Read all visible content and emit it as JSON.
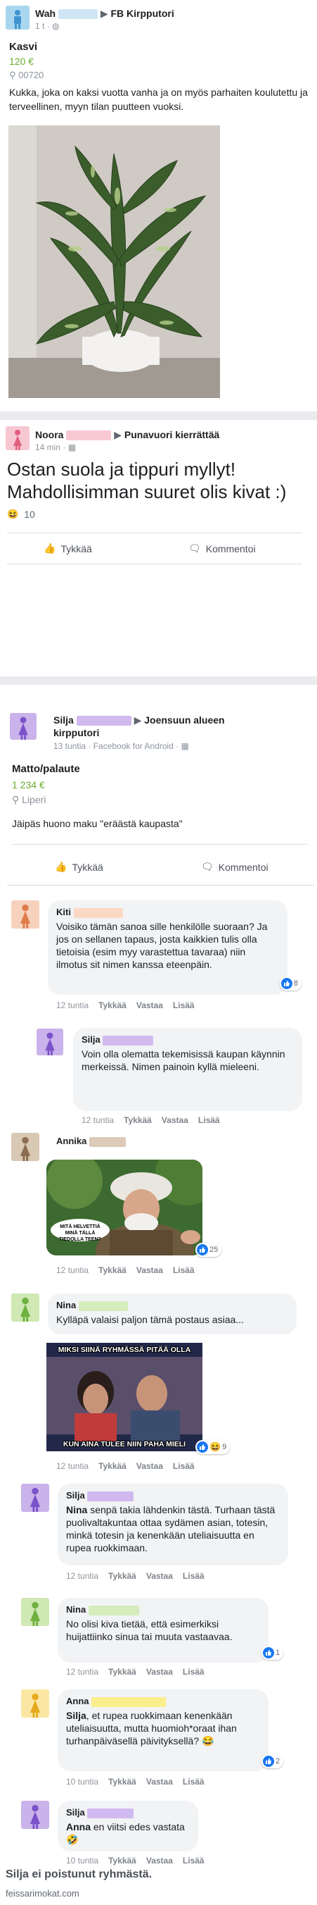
{
  "post1": {
    "author": "Wah",
    "group": "FB Kirpputori",
    "time": "1 t · ",
    "title": "Kasvi",
    "price": "120 €",
    "location": "00720",
    "text": "Kukka, joka on kaksi vuotta vanha ja on myös parhaiten koulutettu ja terveellinen, myyn tilan puutteen vuoksi."
  },
  "post2": {
    "author": "Noora",
    "group": "Punavuori kierrättää",
    "time": "14 min · ",
    "text": "Ostan suola ja tippuri myllyt! Mahdollisimman suuret olis kivat :)",
    "reaction_count": "10",
    "like_label": "Tykkää",
    "comment_label": "Kommentoi"
  },
  "post3": {
    "author": "Silja",
    "group": "Joensuun alueen kirpputori",
    "time": "13 tuntia · Facebook for Android · ",
    "title": "Matto/palaute",
    "price": "1 234 €",
    "location": "Liperi",
    "text": "Jäipäs huono maku \"eräästä kaupasta\"",
    "like_label": "Tykkää",
    "comment_label": "Kommentoi"
  },
  "comments": [
    {
      "name": "Kiti",
      "text": "Voisiko tämän sanoa sille henkilölle suoraan? Ja jos on sellanen tapaus, josta kaikkien tulis olla tietoisia (esim myy varastettua tavaraa) niin ilmotus sit nimen kanssa eteenpäin.",
      "time": "12 tuntia",
      "reactions": "8"
    },
    {
      "name": "Silja",
      "text": "Voin olla olematta tekemisissä kaupan käynnin merkeissä. Nimen painoin kyllä mieleeni.",
      "time": "12 tuntia"
    },
    {
      "name": "Annika",
      "meme_top": "MITÄ HELVETTIÄ MINÄ TÄLLÄ TIEDOLLA TEEN?",
      "time": "12 tuntia",
      "reactions": "25"
    },
    {
      "name": "Nina",
      "text": "Kylläpä valaisi paljon tämä postaus asiaa...",
      "meme_top": "MIKSI SIINÄ RYHMÄSSÄ PITÄÄ OLLA",
      "meme_bottom": "KUN AINA TULEE NIIN PAHA MIELI",
      "time": "12 tuntia",
      "reactions": "9"
    },
    {
      "name": "Silja",
      "mention": "Nina",
      "text": " senpä takia lähdenkin tästä. Turhaan tästä puolivaltakuntaa ottaa sydämen asian, totesin, minkä totesin ja kenenkään uteliaisuutta en rupea ruokkimaan.",
      "time": "12 tuntia"
    },
    {
      "name": "Nina",
      "text": "No olisi kiva tietää, että esimerkiksi huijattiinko sinua tai muuta vastaavaa.",
      "time": "12 tuntia",
      "reactions": "1"
    },
    {
      "name": "Anna",
      "mention": "Silja",
      "text": ", et rupea ruokkimaan kenenkään uteliaisuutta, mutta huomioh*oraat ihan turhanpäiväsellä päivityksellä? 😂",
      "time": "10 tuntia",
      "reactions": "2"
    },
    {
      "name": "Silja",
      "mention": "Anna",
      "text": " en viitsi edes vastata🤣",
      "time": "10 tuntia"
    }
  ],
  "comment_actions": {
    "like": "Tykkää",
    "reply": "Vastaa",
    "more": "Lisää"
  },
  "caption": "Silja ei poistunut ryhmästä.",
  "watermark": "feissarimokat.com",
  "colors": {
    "male_avatar": "#a9d6ef",
    "female_avatar_pink": "#f7c7d1",
    "female_avatar_purple": "#c9b3ea",
    "female_avatar_peach": "#f6d2bd",
    "female_avatar_tan": "#d9c8b4",
    "female_avatar_green": "#cfe8b4",
    "female_avatar_yellow": "#fbe7a3",
    "price_green": "#6aab2e",
    "like_blue": "#1877f2"
  }
}
